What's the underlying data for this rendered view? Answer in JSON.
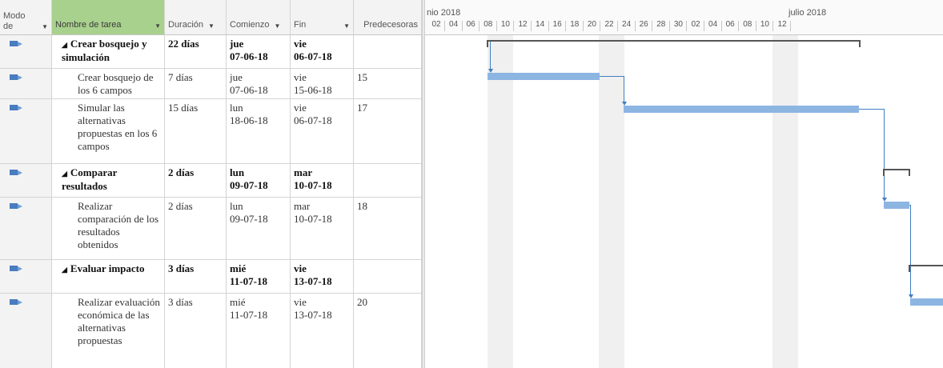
{
  "columns": {
    "mode_line1": "Modo",
    "mode_line2": "de",
    "name": "Nombre de tarea",
    "duration": "Duración",
    "start": "Comienzo",
    "finish": "Fin",
    "predecessors": "Predecesoras"
  },
  "tasks": [
    {
      "name": "Crear bosquejo y simulación",
      "duration": "22 días",
      "start_dow": "jue",
      "start_date": "07-06-18",
      "finish_dow": "vie",
      "finish_date": "06-07-18",
      "pred": ""
    },
    {
      "name": "Crear bosquejo de los 6 campos",
      "duration": "7 días",
      "start_dow": "jue",
      "start_date": "07-06-18",
      "finish_dow": "vie",
      "finish_date": "15-06-18",
      "pred": "15"
    },
    {
      "name": "Simular las alternativas propuestas en los 6 campos",
      "duration": "15 días",
      "start_dow": "lun",
      "start_date": "18-06-18",
      "finish_dow": "vie",
      "finish_date": "06-07-18",
      "pred": "17"
    },
    {
      "name": "Comparar resultados",
      "duration": "2 días",
      "start_dow": "lun",
      "start_date": "09-07-18",
      "finish_dow": "mar",
      "finish_date": "10-07-18",
      "pred": ""
    },
    {
      "name": "Realizar comparación de los resultados obtenidos",
      "duration": "2 días",
      "start_dow": "lun",
      "start_date": "09-07-18",
      "finish_dow": "mar",
      "finish_date": "10-07-18",
      "pred": "18"
    },
    {
      "name": "Evaluar impacto",
      "duration": "3 días",
      "start_dow": "mié",
      "start_date": "11-07-18",
      "finish_dow": "vie",
      "finish_date": "13-07-18",
      "pred": ""
    },
    {
      "name": "Realizar evaluación económica de las alternativas propuestas",
      "duration": "3 días",
      "start_dow": "mié",
      "start_date": "11-07-18",
      "finish_dow": "vie",
      "finish_date": "13-07-18",
      "pred": "20"
    }
  ],
  "timescale": {
    "months": [
      "nio 2018",
      "julio 2018"
    ],
    "days": [
      "02",
      "04",
      "06",
      "08",
      "10",
      "12",
      "14",
      "16",
      "18",
      "20",
      "22",
      "24",
      "26",
      "28",
      "30",
      "02",
      "04",
      "06",
      "08",
      "10",
      "12"
    ]
  },
  "colors": {
    "task_bar": "#8db5e2",
    "summary_bar": "#555555",
    "link": "#3f7fc2",
    "selected_header": "#a9d18e"
  },
  "icons": {
    "task_mode": "auto-scheduled-task-icon",
    "expand": "collapse-triangle-icon"
  }
}
